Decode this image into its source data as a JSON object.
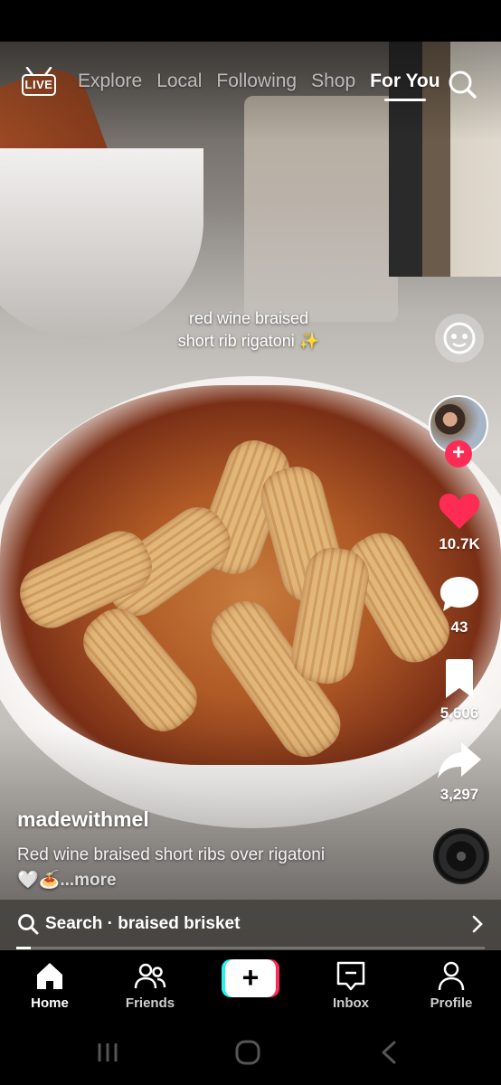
{
  "top_nav": {
    "live_label": "LIVE",
    "tabs": [
      {
        "label": "Explore"
      },
      {
        "label": "Local"
      },
      {
        "label": "Following"
      },
      {
        "label": "Shop"
      },
      {
        "label": "For You"
      }
    ],
    "active_tab": "For You"
  },
  "video": {
    "overlay_text_line1": "red wine braised",
    "overlay_text_line2": "short rib rigatoni ✨"
  },
  "actions": {
    "likes": "10.7K",
    "comments": "43",
    "saves": "5,606",
    "shares": "3,297",
    "like_color": "#fe2c55"
  },
  "post": {
    "author": "madewithmel",
    "description": "Red wine braised short ribs over rigatoni",
    "emojis": "🤍🍝",
    "more_label": "...more"
  },
  "search_suggestion": {
    "label": "Search · braised brisket",
    "progress": 0.03
  },
  "bottom_nav": {
    "home": "Home",
    "friends": "Friends",
    "create": "+",
    "inbox": "Inbox",
    "profile": "Profile"
  }
}
